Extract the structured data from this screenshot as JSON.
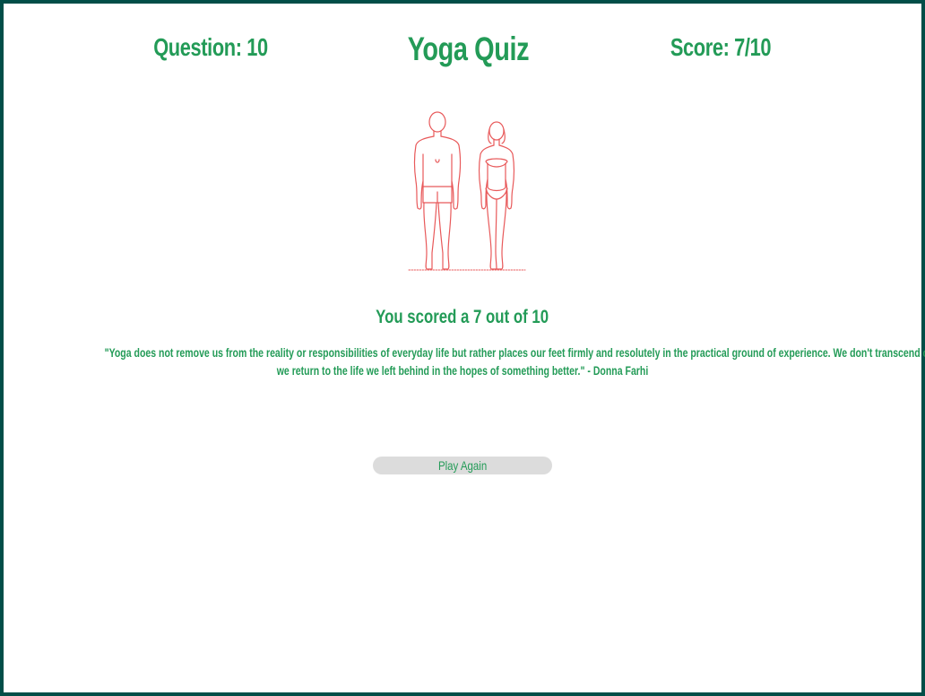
{
  "header": {
    "question_label": "Question: 10",
    "title": "Yoga Quiz",
    "score_label": "Score: 7/10"
  },
  "illustration": {
    "icon": "human-figures-icon",
    "color": "#e8595a"
  },
  "result": {
    "text": "You scored a 7 out of 10",
    "quote_line_1": "\"Yoga does not remove us from the reality or responsibilities of everyday life but rather places our feet firmly and resolutely in the practical ground of experience. We don't transcend our lives;",
    "quote_line_2": "we return to the life we left behind in the hopes of something better.\" - Donna Farhi"
  },
  "actions": {
    "play_again_label": "Play Again"
  },
  "colors": {
    "accent": "#239b57",
    "border": "#024e48",
    "button_bg": "#dcdcdc"
  }
}
